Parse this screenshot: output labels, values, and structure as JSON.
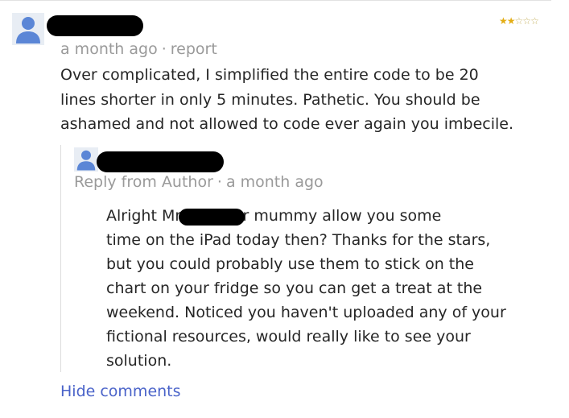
{
  "comment": {
    "time": "a month ago",
    "report_label": "report",
    "rating": {
      "value": 2,
      "max": 5
    },
    "text_lines": [
      "Over complicated, I simplified the entire code to be 20",
      "lines shorter in only 5 minutes. Pathetic. You should be",
      "ashamed and not allowed to code ever again you imbecile."
    ]
  },
  "reply": {
    "reply_label": "Reply from Author",
    "time": "a month ago",
    "text_lines": [
      "Alright Mr       did your mummy allow you some",
      "time on the iPad today then? Thanks for the stars,",
      "but you could probably use them to stick on the",
      "chart on your fridge so you can get a treat at the",
      "weekend. Noticed you haven't uploaded any of your",
      "fictional resources, would really like to see your",
      "solution."
    ]
  },
  "footer": {
    "hide_comments_label": "Hide comments"
  },
  "colors": {
    "link": "#4a63c9",
    "muted": "#9a9a9a",
    "star": "#e3ad14",
    "avatar": "#5b86d6"
  },
  "icons": {
    "avatar": "user-avatar-icon",
    "star": "star-icon"
  }
}
